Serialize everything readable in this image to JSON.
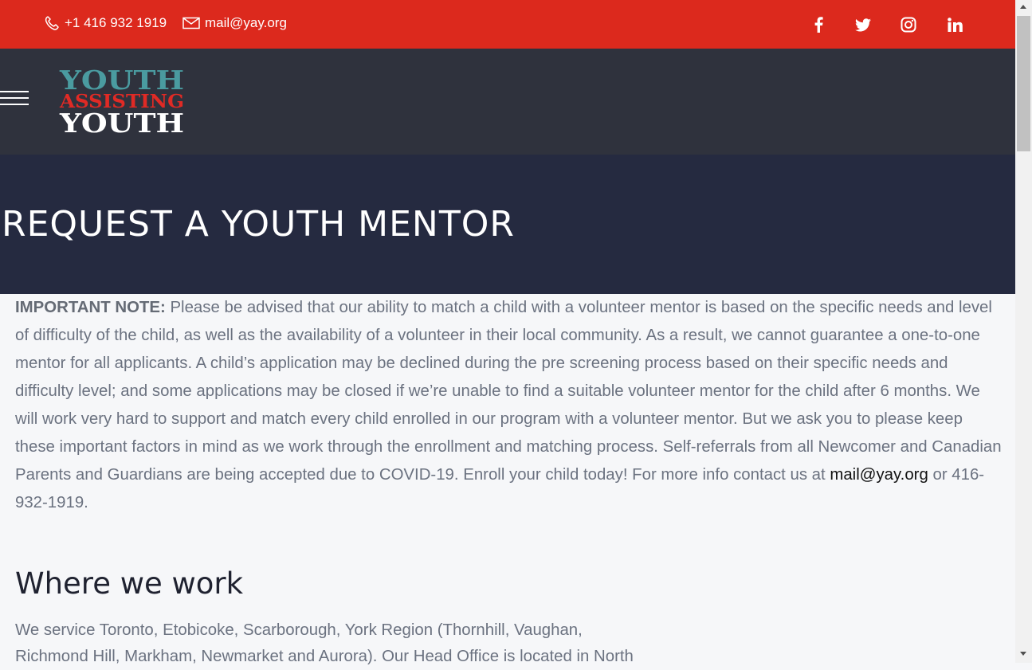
{
  "topbar": {
    "phone": "+1 416 932 1919",
    "email": "mail@yay.org",
    "social": [
      "facebook-icon",
      "twitter-icon",
      "instagram-icon",
      "linkedin-icon"
    ]
  },
  "logo": {
    "line1": "YOUTH",
    "line2": "ASSISTING",
    "line3": "YOUTH"
  },
  "hero": {
    "title": "REQUEST A YOUTH MENTOR"
  },
  "content": {
    "note_label": "IMPORTANT NOTE:",
    "note_text": " Please be advised that our ability to match a child with a volunteer mentor is based on the specific needs and level of difficulty of the child, as well as the availability of a volunteer in their local community. As a result, we cannot guarantee a one-to-one mentor for all applicants. A child’s application may be declined during the pre screening process based on their specific needs and difficulty level; and some applications may be closed if we’re unable to find a suitable volunteer mentor for the child after 6 months. We will work very hard to support and match every child enrolled in our program with a volunteer mentor. But we ask you to please keep these important factors in mind as we work through the enrollment and matching process. Self-referrals from all Newcomer and Canadian Parents and Guardians are being accepted due to COVID-19. Enroll your child today! For more info contact us at ",
    "note_email": "mail@yay.org",
    "note_end": " or 416-932-1919.",
    "where_heading": "Where we work",
    "where_text": "We service Toronto, Etobicoke, Scarborough, York Region (Thornhill, Vaughan, Richmond Hill, Markham, Newmarket and Aurora). Our Head Office is located in North"
  },
  "colors": {
    "topbar": "#dc291d",
    "navbar": "#2f323d",
    "hero": "#252a40",
    "logo_teal": "#4a9ba0",
    "logo_red": "#e02a25"
  }
}
